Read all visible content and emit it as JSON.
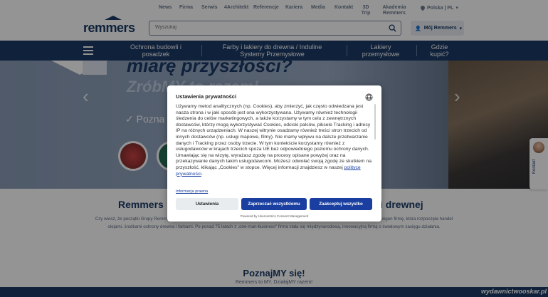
{
  "header": {
    "logo_text": "remmers",
    "topnav": [
      "News",
      "Firma",
      "Serwis",
      "4Architekt",
      "Referencje",
      "Kariera",
      "Media",
      "Kontakt",
      "3D Trip",
      "Akademia Remmers"
    ],
    "language": "Polska | PL",
    "search_placeholder": "Wyszukaj",
    "account_label": "Mój Remmers"
  },
  "mainnav": {
    "items": [
      "Ochrona budowli i posadzek",
      "Farby i lakiery do drewna / Induline Systemy Przemysłowe",
      "Lakiery przemysłowe",
      "Gdzie kupić?"
    ]
  },
  "hero": {
    "line1": "miarę przyszłości?",
    "line2": "ZróbMY to razem!",
    "poznaj": "Pozna"
  },
  "side_contact": {
    "label": "Kontakt"
  },
  "section": {
    "title_left": "Remmers",
    "title_right": "i drewnej",
    "intro": "Czy wiesz, że początki Grupy Remmers ... czach trwała intensywna odbudowa kraju. Bernhard Remmers założył wówczas w dolnosaksońskim Löningen firmę, która rozpoczęła handel olejami, środkami ochrony drewna i farbami. Po ponad 75 latach z „one-man-business\" firma stała się międzynarodową, innowacyjną firmą o światowym zasięgu działania."
  },
  "poznajmy": {
    "title": "PoznajMY się!",
    "subtitle": "Remmers to MY. DziałajMY razem!"
  },
  "watermark": "wydawnictwooskar.pl",
  "modal": {
    "title": "Ustawienia prywatności",
    "body_text": "Używamy metod analitycznych (np. Cookies), aby zmierzyć, jak często odwiedzana jest nasza strona i w jaki sposób jest ona wykorzystywana. Używamy również technologii śledzenia do celów marketingowych, a także korzystamy w tym celu z zewnętrznych dostawców, którzy mogą wykorzystywać Cookies, odciski palców, piksele Tracking i adresy IP na różnych urządzeniach. W naszej witrynie osadzamy również treści stron trzecich od innych dostawców (np. usługi mapowe, filmy). Nie mamy wpływu na dalsze przetwarzanie danych i Tracking przez osoby trzecie. W tym kontekście korzystamy również z usługodawców w krajach trzecich spoza UE bez odpowiedniego poziomu ochrony danych. Umawiając się na wizytę, wyrażasz zgodę na procesy opisane powyżej oraz na przekazywanie danych takim usługodawcom. Możesz odwołać swoją zgodę ze skutkiem na przyszłość, klikając „Cookies\" w stopce. Więcej informacji znajdziesz w naszej",
    "body_link": "polityce prywatności",
    "policy_link": "Informacja prawna",
    "btn_settings": "Ustawienia",
    "btn_reject": "Zaprzeczać wszystkiemu",
    "btn_accept": "Zaakceptuj wszystko",
    "powered_by": "Powered by Usercentrics Consent Management"
  },
  "colors": {
    "brand_navy": "#1b3a66",
    "button_blue": "#1a3fa0"
  }
}
